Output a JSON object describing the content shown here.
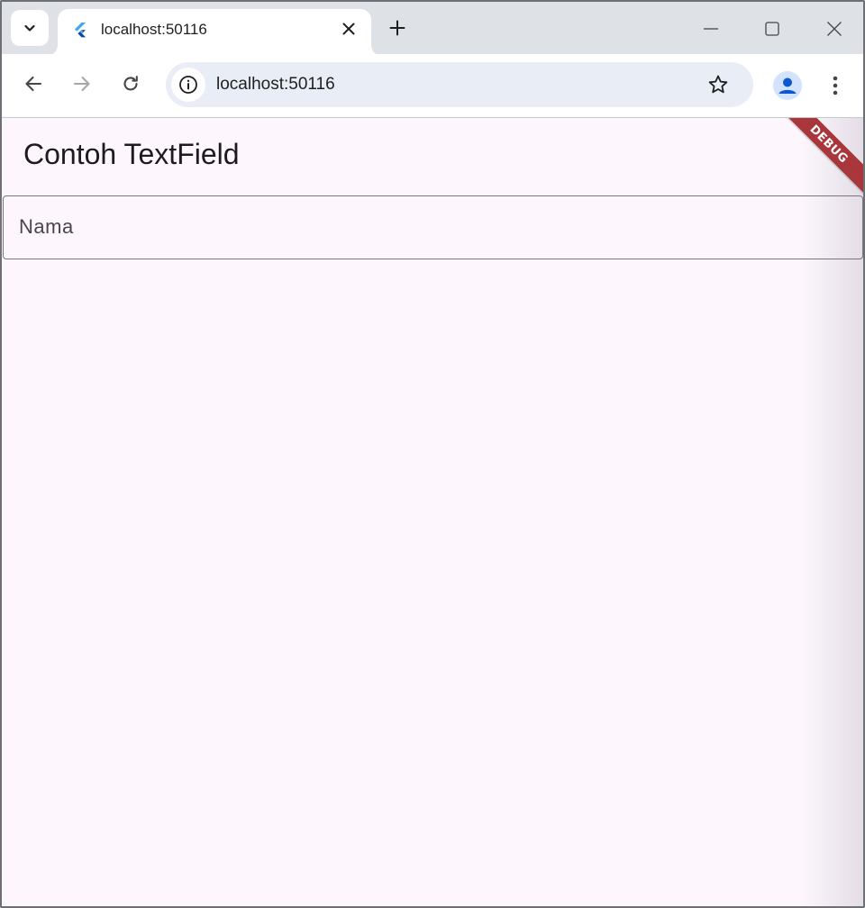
{
  "browser": {
    "tab": {
      "title": "localhost:50116",
      "favicon": "flutter-icon"
    },
    "address_bar": {
      "url": "localhost:50116"
    },
    "icons": {
      "tab_search": "chevron-down-icon",
      "tab_close": "close-icon",
      "new_tab": "plus-icon",
      "minimize": "minimize-icon",
      "maximize": "maximize-icon",
      "close_window": "close-icon",
      "back": "arrow-left-icon",
      "forward": "arrow-right-icon",
      "reload": "reload-icon",
      "site_info": "info-icon",
      "bookmark": "star-icon",
      "profile": "profile-icon",
      "menu": "kebab-menu-icon"
    }
  },
  "app": {
    "appbar": {
      "title": "Contoh TextField"
    },
    "textfield": {
      "label": "Nama",
      "value": ""
    },
    "debug_banner": {
      "text": "DEBUG",
      "color": "#a8363a"
    },
    "background_color": "#fdf7fd"
  }
}
